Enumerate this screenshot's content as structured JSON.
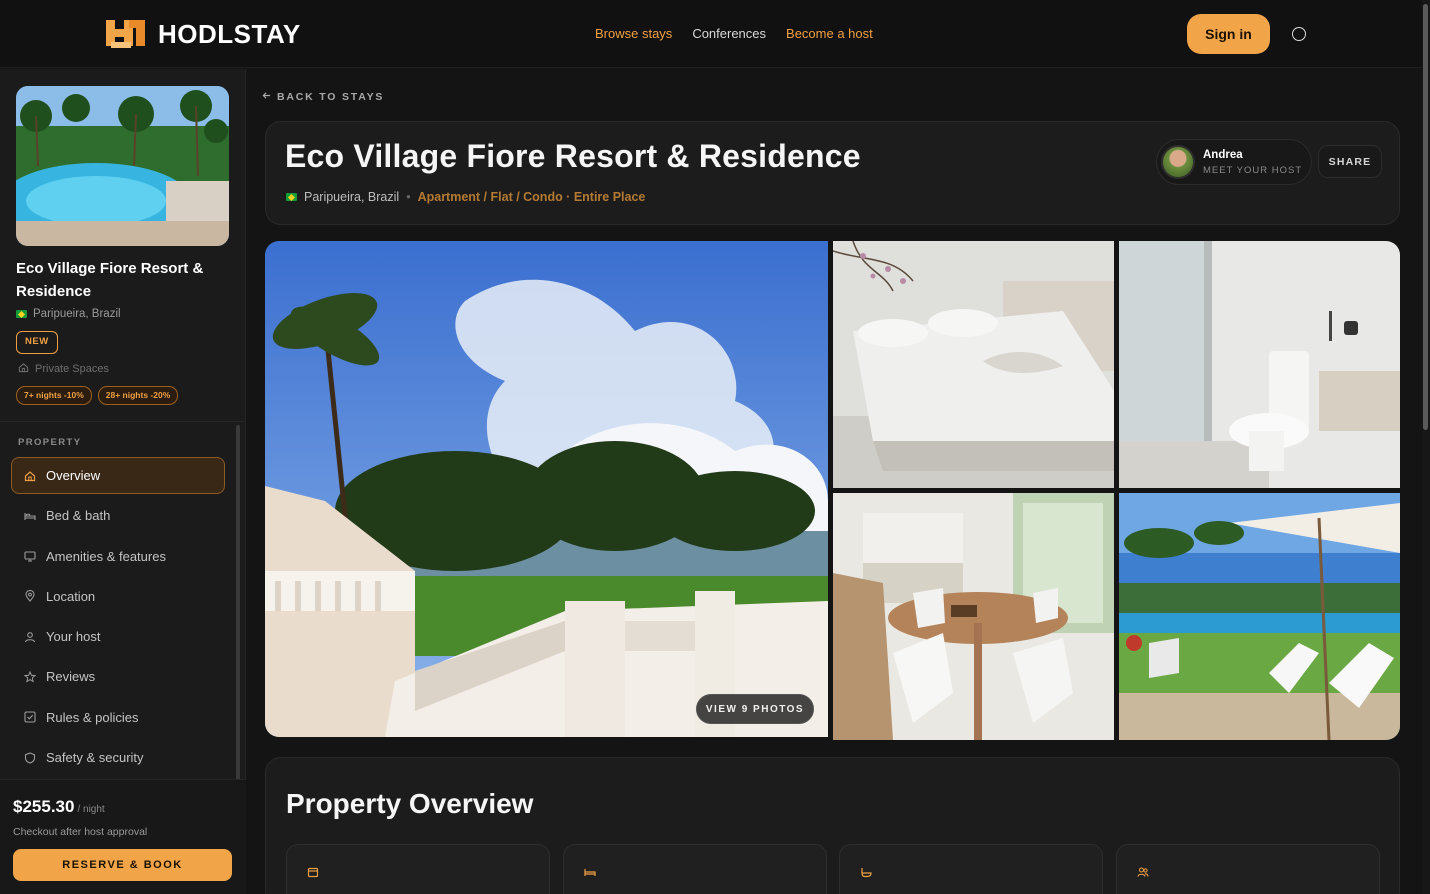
{
  "brand": {
    "name": "HODLSTAY",
    "accent": "#f2a449",
    "logo_icon": "hodlstay-logo"
  },
  "nav": {
    "links": [
      {
        "label": "Browse stays",
        "color": "#f0a044"
      },
      {
        "label": "Conferences",
        "color": "#d8d8d8"
      },
      {
        "label": "Become a host",
        "color": "#f0a044"
      }
    ],
    "signin_label": "Sign in",
    "theme_icon": "circle-toggle-icon"
  },
  "sidebar": {
    "title": "Eco Village Fiore Resort & Residence",
    "location": "Paripueira, Brazil",
    "badge": "NEW",
    "space_type": "Private Spaces",
    "discounts": [
      "7+ nights -10%",
      "28+ nights -20%"
    ],
    "section_label": "PROPERTY",
    "menu": [
      {
        "label": "Overview",
        "icon": "home-icon",
        "active": true
      },
      {
        "label": "Bed & bath",
        "icon": "bed-icon",
        "active": false
      },
      {
        "label": "Amenities & features",
        "icon": "monitor-icon",
        "active": false
      },
      {
        "label": "Location",
        "icon": "map-pin-icon",
        "active": false
      },
      {
        "label": "Your host",
        "icon": "user-icon",
        "active": false
      },
      {
        "label": "Reviews",
        "icon": "star-icon",
        "active": false
      },
      {
        "label": "Rules & policies",
        "icon": "checkbox-icon",
        "active": false
      },
      {
        "label": "Safety & security",
        "icon": "shield-icon",
        "active": false
      }
    ],
    "price": "$255.30",
    "price_unit": "/ night",
    "checkout_note": "Checkout after host approval",
    "reserve_label": "RESERVE & BOOK"
  },
  "main": {
    "back_label": "BACK TO STAYS",
    "title": "Eco Village Fiore Resort & Residence",
    "location": "Paripueira, Brazil",
    "property_type": "Apartment / Flat / Condo · Entire Place",
    "host": {
      "name": "Andrea",
      "subtitle": "MEET YOUR HOST"
    },
    "share_label": "SHARE",
    "gallery": {
      "view_photos_label": "VIEW 9 PHOTOS",
      "photos": [
        "terrace-view-photo",
        "bedroom-photo",
        "bathroom-photo",
        "kitchen-dining-photo",
        "pool-loungers-photo"
      ]
    },
    "overview": {
      "title": "Property Overview",
      "stat_icons": [
        "property-icon",
        "bed-icon",
        "bath-icon",
        "guests-icon"
      ]
    }
  }
}
